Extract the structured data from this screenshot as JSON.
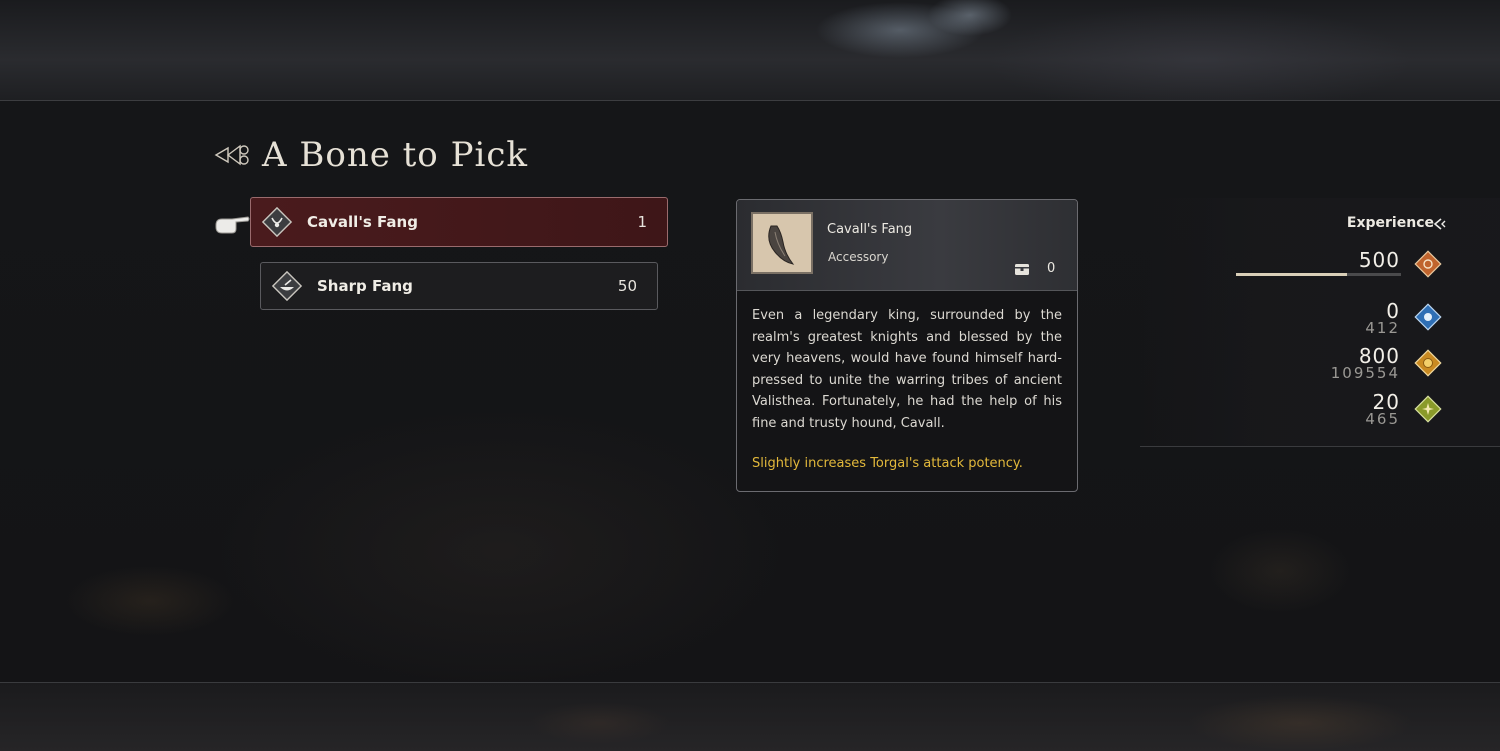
{
  "quest": {
    "title": "A Bone to Pick"
  },
  "items": [
    {
      "name": "Cavall's Fang",
      "qty": "1",
      "selected": true
    },
    {
      "name": "Sharp Fang",
      "qty": "50",
      "selected": false
    }
  ],
  "detail": {
    "name": "Cavall's Fang",
    "type": "Accessory",
    "owned": "0",
    "description": "Even a legendary king, surrounded by the realm's greatest knights and blessed by the very heavens, would have found himself hard-pressed to unite the warring tribes of ancient Valisthea. Fortunately, he had the help of his fine and trusty hound, Cavall.",
    "effect": "Slightly increases Torgal's attack potency."
  },
  "rewards": {
    "label": "Experience",
    "experience": {
      "value": "500",
      "progress": 0.67
    },
    "ability_points": {
      "value": "0",
      "total": "412"
    },
    "gil": {
      "value": "800",
      "total": "109554"
    },
    "renown": {
      "value": "20",
      "total": "465"
    }
  },
  "colors": {
    "selected_bg": "#4a1b1d",
    "effect_text": "#e3b93b",
    "exp_icon": "#c0642d",
    "ap_icon": "#2f6fb5",
    "gil_icon": "#c98a22",
    "renown_icon": "#8a9a2a"
  }
}
